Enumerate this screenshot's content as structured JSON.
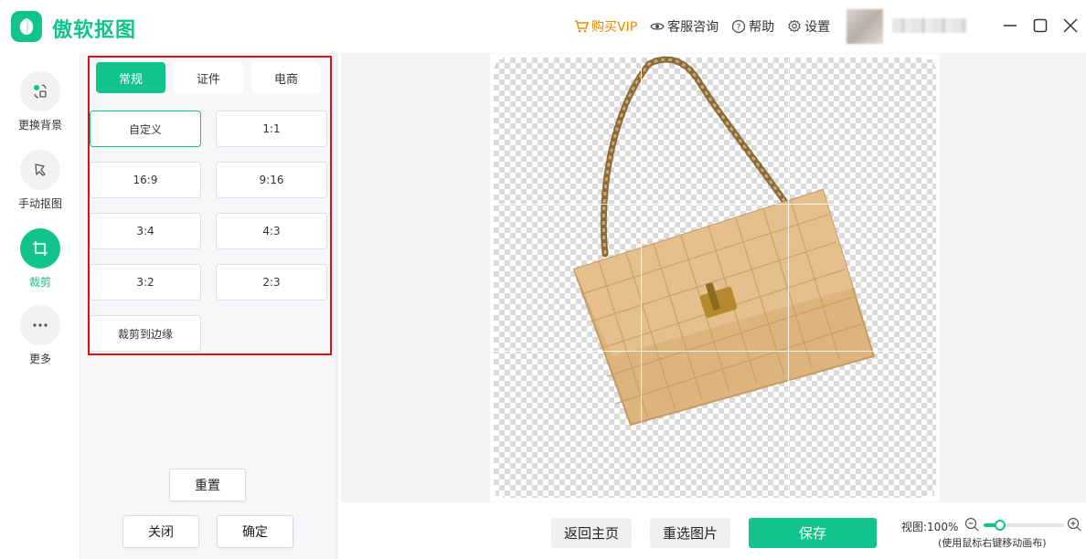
{
  "app": {
    "title": "傲软抠图",
    "accent": "#12c48b",
    "warning": "#e0101a"
  },
  "header": {
    "vip_label": "购买VIP",
    "support_label": "客服咨询",
    "help_label": "帮助",
    "settings_label": "设置"
  },
  "nav": {
    "items": [
      {
        "label": "更换背景",
        "icon": "swap-background-icon"
      },
      {
        "label": "手动抠图",
        "icon": "manual-cutout-icon"
      },
      {
        "label": "裁剪",
        "icon": "crop-icon",
        "active": true
      },
      {
        "label": "更多",
        "icon": "more-icon"
      }
    ]
  },
  "panel": {
    "tabs": [
      "常规",
      "证件",
      "电商"
    ],
    "active_tab": "常规",
    "ratios": [
      "自定义",
      "1:1",
      "16:9",
      "9:16",
      "3:4",
      "4:3",
      "3:2",
      "2:3",
      "裁剪到边缘"
    ],
    "selected_ratio": "自定义",
    "reset_label": "重置",
    "close_label": "关闭",
    "confirm_label": "确定"
  },
  "bottom": {
    "home_label": "返回主页",
    "reselect_label": "重选图片",
    "save_label": "保存",
    "zoom_text": "视图:100%",
    "zoom_hint": "(使用鼠标右键移动画布)",
    "zoom_level": 0.2
  }
}
